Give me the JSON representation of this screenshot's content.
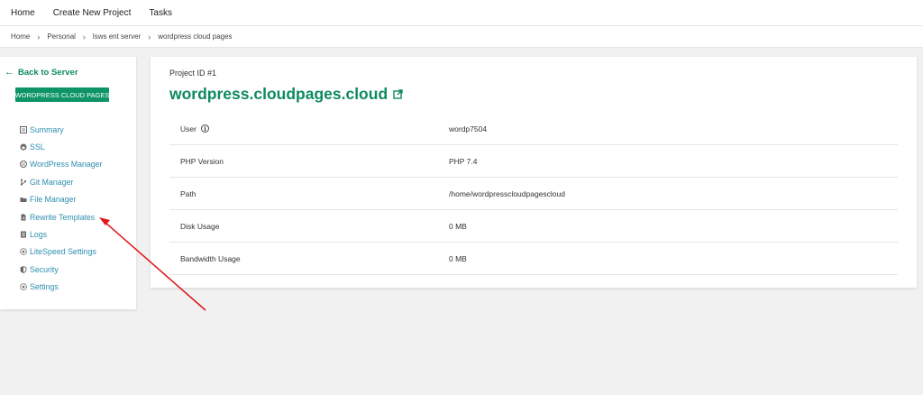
{
  "topnav": {
    "items": [
      "Home",
      "Create New Project",
      "Tasks"
    ]
  },
  "breadcrumb": {
    "items": [
      "Home",
      "Personal",
      "lsws ent server",
      "wordpress cloud pages"
    ],
    "separator": "›"
  },
  "sidebar": {
    "back_label": "Back to Server",
    "project_badge": "WORDPRESS CLOUD PAGES",
    "items": [
      {
        "label": "Summary",
        "icon": "list-icon"
      },
      {
        "label": "SSL",
        "icon": "lock-icon"
      },
      {
        "label": "WordPress Manager",
        "icon": "wordpress-icon"
      },
      {
        "label": "Git Manager",
        "icon": "git-branch-icon"
      },
      {
        "label": "File Manager",
        "icon": "folder-icon"
      },
      {
        "label": "Rewrite Templates",
        "icon": "file-icon"
      },
      {
        "label": "Logs",
        "icon": "document-icon"
      },
      {
        "label": "LiteSpeed Settings",
        "icon": "gear-icon"
      },
      {
        "label": "Security",
        "icon": "shield-icon"
      },
      {
        "label": "Settings",
        "icon": "gear-icon"
      }
    ]
  },
  "project": {
    "id_label": "Project ID #1",
    "domain": "wordpress.cloudpages.cloud",
    "details": [
      {
        "label": "User",
        "value": "wordp7504",
        "has_info": true
      },
      {
        "label": "PHP Version",
        "value": "PHP 7.4",
        "has_info": false
      },
      {
        "label": "Path",
        "value": "/home/wordpresscloudpagescloud",
        "has_info": false
      },
      {
        "label": "Disk Usage",
        "value": "0 MB",
        "has_info": false
      },
      {
        "label": "Bandwidth Usage",
        "value": "0 MB",
        "has_info": false
      }
    ]
  },
  "colors": {
    "accent_green": "#0e8a5f",
    "link_blue": "#2e8fb0",
    "annotation_red": "#e0161b"
  }
}
